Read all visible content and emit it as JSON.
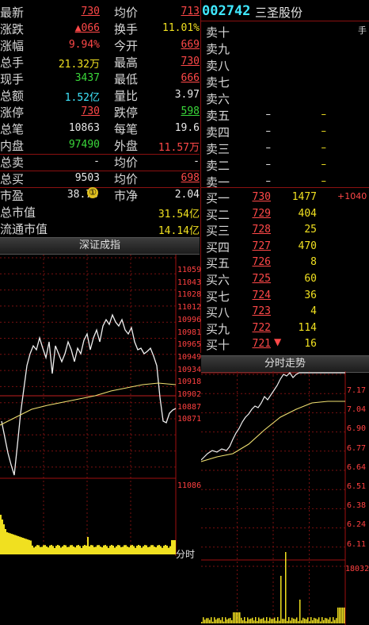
{
  "quote": {
    "last_label": "最新",
    "last": "730",
    "avg_label": "均价",
    "avg": "713",
    "change_label": "涨跌",
    "change": "▲066",
    "turnover_label": "换手",
    "turnover": "11.01%",
    "pct_label": "涨幅",
    "pct": "9.94%",
    "open_label": "今开",
    "open": "669",
    "volume_label": "总手",
    "volume": "21.32万",
    "high_label": "最高",
    "high": "730",
    "cur_label": "现手",
    "cur": "3437",
    "low_label": "最低",
    "low": "666",
    "amount_label": "总额",
    "amount": "1.52亿",
    "ratio_label": "量比",
    "ratio": "3.97",
    "limitup_label": "涨停",
    "limitup": "730",
    "limitdown_label": "跌停",
    "limitdown": "598",
    "trades_label": "总笔",
    "trades": "10863",
    "pertrade_label": "每笔",
    "pertrade": "19.6",
    "inner_label": "内盘",
    "inner": "97490",
    "outer_label": "外盘",
    "outer": "11.57万",
    "totsell_label": "总卖",
    "totsell": "-",
    "sellavg_label": "均价",
    "sellavg": "-",
    "totbuy_label": "总买",
    "totbuy": "9503",
    "buyavg_label": "均价",
    "buyavg": "698",
    "pe_label": "市盈",
    "pe": "38.78",
    "pe_badge": "①",
    "pb_label": "市净",
    "pb": "2.04",
    "mktcap_label": "总市值",
    "mktcap": "31.54亿",
    "float_label": "流通市值",
    "float": "14.14亿"
  },
  "stock": {
    "code": "002742",
    "name": "三圣股份",
    "unit": "手"
  },
  "sell_levels": [
    {
      "name": "卖十",
      "price": "",
      "vol": ""
    },
    {
      "name": "卖九",
      "price": "",
      "vol": ""
    },
    {
      "name": "卖八",
      "price": "",
      "vol": ""
    },
    {
      "name": "卖七",
      "price": "",
      "vol": ""
    },
    {
      "name": "卖六",
      "price": "",
      "vol": ""
    },
    {
      "name": "卖五",
      "price": "–",
      "vol": "–"
    },
    {
      "name": "卖四",
      "price": "–",
      "vol": "–"
    },
    {
      "name": "卖三",
      "price": "–",
      "vol": "–"
    },
    {
      "name": "卖二",
      "price": "–",
      "vol": "–"
    },
    {
      "name": "卖一",
      "price": "–",
      "vol": "–"
    }
  ],
  "buy_levels": [
    {
      "name": "买一",
      "price": "730",
      "vol": "1477",
      "extra": "+1040"
    },
    {
      "name": "买二",
      "price": "729",
      "vol": "404",
      "extra": ""
    },
    {
      "name": "买三",
      "price": "728",
      "vol": "25",
      "extra": ""
    },
    {
      "name": "买四",
      "price": "727",
      "vol": "470",
      "extra": ""
    },
    {
      "name": "买五",
      "price": "726",
      "vol": "8",
      "extra": ""
    },
    {
      "name": "买六",
      "price": "725",
      "vol": "60",
      "extra": ""
    },
    {
      "name": "买七",
      "price": "724",
      "vol": "36",
      "extra": ""
    },
    {
      "name": "买八",
      "price": "723",
      "vol": "4",
      "extra": ""
    },
    {
      "name": "买九",
      "price": "722",
      "vol": "114",
      "extra": ""
    },
    {
      "name": "买十",
      "price": "721",
      "vol": "16",
      "extra": "▼"
    }
  ],
  "index_chart": {
    "title": "深证成指",
    "ticks": [
      "11059",
      "11043",
      "11028",
      "11012",
      "10996",
      "10981",
      "10965",
      "10949",
      "10934",
      "10918",
      "10902",
      "10887",
      "10871"
    ],
    "vol_tick": "11086",
    "time_label": "分时"
  },
  "intraday_chart": {
    "title": "分时走势",
    "ticks": [
      "7.17",
      "7.04",
      "6.90",
      "6.77",
      "6.64",
      "6.51",
      "6.38",
      "6.24",
      "6.11"
    ],
    "vol_tick": "18032"
  },
  "colors": {
    "up": "#ff4848",
    "down": "#3ad83a",
    "accent": "#40e8ff",
    "grid": "#8a1010"
  }
}
